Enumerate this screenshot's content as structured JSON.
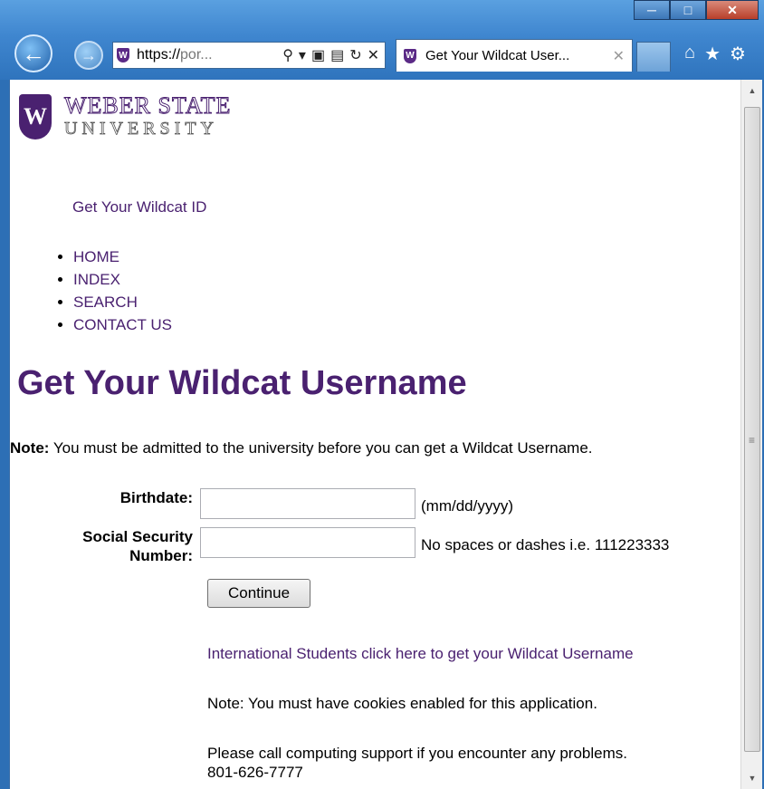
{
  "browser": {
    "address": {
      "prefix": "https://",
      "rest": "por..."
    },
    "tab": {
      "title": "Get Your Wildcat User...",
      "favicon": "W"
    }
  },
  "logo": {
    "line1": "WEBER STATE",
    "line2": "UNIVERSITY",
    "mark": "W"
  },
  "site": {
    "name": "Get Your Wildcat ID"
  },
  "nav": {
    "items": [
      "HOME",
      "INDEX",
      "SEARCH",
      "CONTACT US"
    ]
  },
  "page": {
    "title": "Get Your Wildcat Username",
    "note_label": "Note:",
    "note_text": " You must be admitted to the university before you can get a Wildcat Username."
  },
  "form": {
    "birthdate_label": "Birthdate:",
    "birthdate_value": "",
    "birthdate_hint": "(mm/dd/yyyy)",
    "ssn_label_line1": "Social Security",
    "ssn_label_line2": "Number:",
    "ssn_value": "",
    "ssn_hint": "No spaces or dashes i.e. 111223333",
    "continue_label": "Continue"
  },
  "footer": {
    "intl_link": "International Students click here to get your Wildcat Username",
    "cookie_note": "Note: You must have cookies enabled for this application.",
    "support_line1": "Please call computing support if you encounter any problems.",
    "support_line2": "801-626-7777"
  },
  "colors": {
    "brand_purple": "#4a2170",
    "chrome_blue": "#2d6fb5"
  }
}
